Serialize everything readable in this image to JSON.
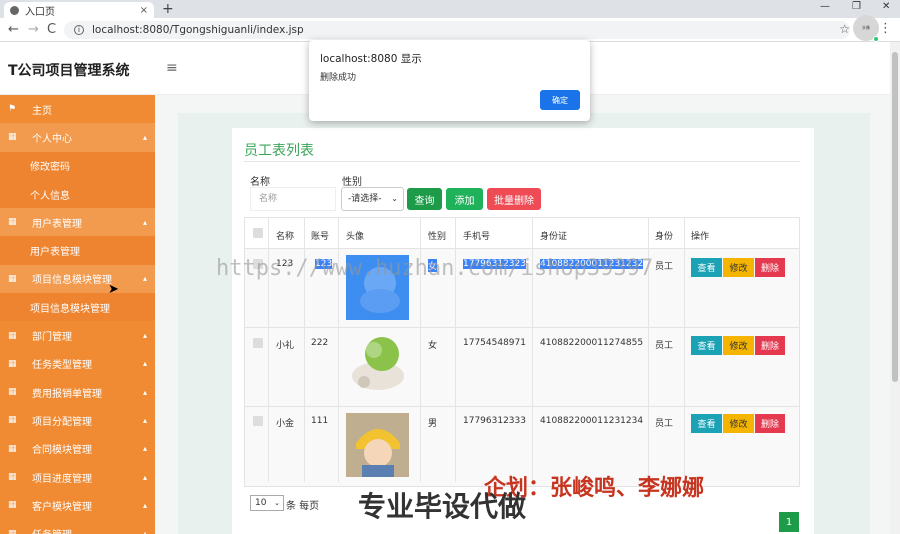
{
  "browser": {
    "tab_title": "入口页",
    "tab_close": "×",
    "new_tab": "+",
    "win_min": "—",
    "win_max": "❐",
    "win_close": "✕",
    "back": "←",
    "forward": "→",
    "reload": "C",
    "url": "localhost:8080/Tgongshiguanli/index.jsp",
    "star": "☆",
    "menu": "⋮"
  },
  "header": {
    "brand": "T公司项目管理系统",
    "hamburger": "≡",
    "avatar_text": "头像"
  },
  "sidebar": {
    "items": [
      {
        "label": "主页",
        "icon": "⚑",
        "type": "parent",
        "caret": ""
      },
      {
        "label": "个人中心",
        "icon": "▦",
        "type": "open",
        "caret": "▴"
      },
      {
        "label": "修改密码",
        "icon": "",
        "type": "sub",
        "caret": ""
      },
      {
        "label": "个人信息",
        "icon": "",
        "type": "sub",
        "caret": ""
      },
      {
        "label": "用户表管理",
        "icon": "▦",
        "type": "open",
        "caret": "▴"
      },
      {
        "label": "用户表管理",
        "icon": "",
        "type": "sub",
        "caret": ""
      },
      {
        "label": "项目信息模块管理",
        "icon": "▦",
        "type": "open",
        "caret": "▴"
      },
      {
        "label": "项目信息模块管理",
        "icon": "",
        "type": "sub",
        "caret": ""
      },
      {
        "label": "部门管理",
        "icon": "▦",
        "type": "parent",
        "caret": "▴"
      },
      {
        "label": "任务类型管理",
        "icon": "▦",
        "type": "parent",
        "caret": "▴"
      },
      {
        "label": "费用报销单管理",
        "icon": "▦",
        "type": "parent",
        "caret": "▴"
      },
      {
        "label": "项目分配管理",
        "icon": "▦",
        "type": "parent",
        "caret": "▴"
      },
      {
        "label": "合同模块管理",
        "icon": "▦",
        "type": "parent",
        "caret": "▴"
      },
      {
        "label": "项目进度管理",
        "icon": "▦",
        "type": "parent",
        "caret": "▴"
      },
      {
        "label": "客户模块管理",
        "icon": "▦",
        "type": "parent",
        "caret": "▴"
      },
      {
        "label": "任务管理",
        "icon": "▦",
        "type": "parent",
        "caret": "▴"
      }
    ]
  },
  "main": {
    "title": "员工表列表",
    "search": {
      "name_label": "名称",
      "name_placeholder": "名称",
      "sex_label": "性别",
      "sex_value": "-请选择-",
      "query_button": "查询",
      "add_button": "添加",
      "bulk_delete_button": "批量删除"
    },
    "table": {
      "headers": [
        "名称",
        "账号",
        "头像",
        "性别",
        "手机号",
        "身份证",
        "身份",
        "操作"
      ],
      "rows": [
        {
          "name": "123",
          "account": "123",
          "sex": "女",
          "phone": "17796312323",
          "idcard": "410882200011231232",
          "role": "员工",
          "highlight": true
        },
        {
          "name": "小礼",
          "account": "222",
          "sex": "女",
          "phone": "17754548971",
          "idcard": "410882200011274855",
          "role": "员工",
          "highlight": false
        },
        {
          "name": "小金",
          "account": "111",
          "sex": "男",
          "phone": "17796312333",
          "idcard": "410882200011231234",
          "role": "员工",
          "highlight": false
        }
      ],
      "view_label": "查看",
      "edit_label": "修改",
      "delete_label": "删除"
    },
    "page_size": "10",
    "page_size_label": "条 每页",
    "current_page": "1"
  },
  "dialog": {
    "title": "localhost:8080 显示",
    "message": "删除成功",
    "ok": "确定"
  },
  "watermarks": {
    "url": "https://www.huzhan.com/ishop39397",
    "plan": "企划：张峻鸣、李娜娜",
    "pro": "专业毕设代做"
  }
}
